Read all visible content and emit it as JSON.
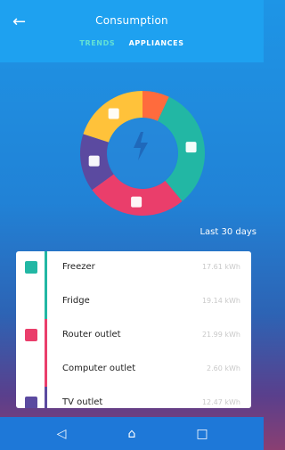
{
  "header": {
    "back_icon": "arrow-left-icon",
    "title": "Consumption",
    "tabs": [
      {
        "label": "TRENDS",
        "active": true
      },
      {
        "label": "APPLIANCES",
        "active": false
      }
    ]
  },
  "chart": {
    "period_label": "Last 30 days",
    "segments": [
      {
        "name": "orange",
        "color": "#ff6b3d",
        "value": 7
      },
      {
        "name": "teal",
        "color": "#22b7a4",
        "value": 32
      },
      {
        "name": "pink",
        "color": "#ea3e6b",
        "value": 26
      },
      {
        "name": "purple",
        "color": "#5b4aa0",
        "value": 15
      },
      {
        "name": "yellow",
        "color": "#ffc23a",
        "value": 20
      }
    ],
    "center_icon": "bolt-icon"
  },
  "appliances": [
    {
      "name": "Freezer",
      "value": "17.61 kWh",
      "accent": "#22b7a4",
      "icon": "freezer-icon"
    },
    {
      "name": "Fridge",
      "value": "19.14 kWh",
      "accent": "#22b7a4",
      "icon": ""
    },
    {
      "name": "Router outlet",
      "value": "21.99 kWh",
      "accent": "#ea3e6b",
      "icon": "router-icon"
    },
    {
      "name": "Computer outlet",
      "value": "2.60 kWh",
      "accent": "#ea3e6b",
      "icon": ""
    },
    {
      "name": "TV outlet",
      "value": "12.47 kWh",
      "accent": "#5b4aa0",
      "icon": "tv-icon"
    }
  ],
  "nav": {
    "back_icon": "nav-back-icon",
    "home_icon": "nav-home-icon",
    "recents_icon": "nav-recents-icon"
  }
}
